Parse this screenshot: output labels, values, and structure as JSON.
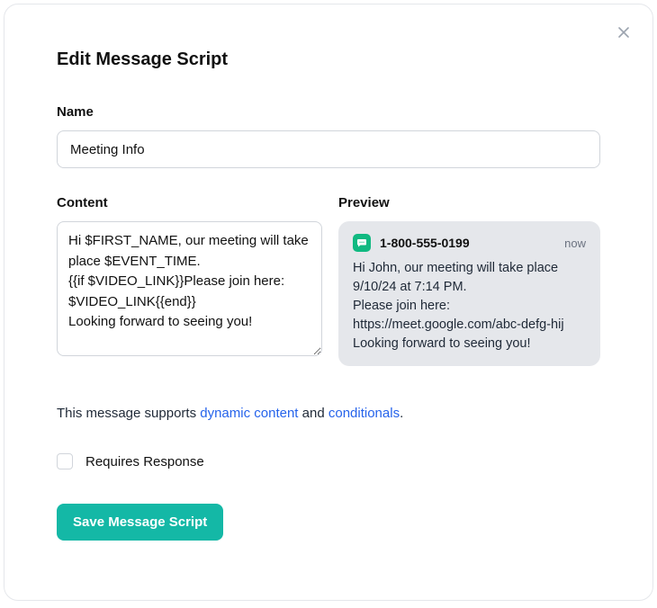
{
  "title": "Edit Message Script",
  "name_field": {
    "label": "Name",
    "value": "Meeting Info"
  },
  "content_field": {
    "label": "Content",
    "value": "Hi $FIRST_NAME, our meeting will take place $EVENT_TIME.\n{{if $VIDEO_LINK}}Please join here: $VIDEO_LINK{{end}}\nLooking forward to seeing you!"
  },
  "preview": {
    "label": "Preview",
    "sender": "1-800-555-0199",
    "time": "now",
    "body": "Hi John, our meeting will take place 9/10/24 at 7:14 PM.\nPlease join here: https://meet.google.com/abc-defg-hij\nLooking forward to seeing you!"
  },
  "support": {
    "prefix": "This message supports ",
    "link1": "dynamic content",
    "mid": " and ",
    "link2": "conditionals",
    "suffix": "."
  },
  "requires_response": {
    "label": "Requires Response",
    "checked": false
  },
  "save_label": "Save Message Script"
}
